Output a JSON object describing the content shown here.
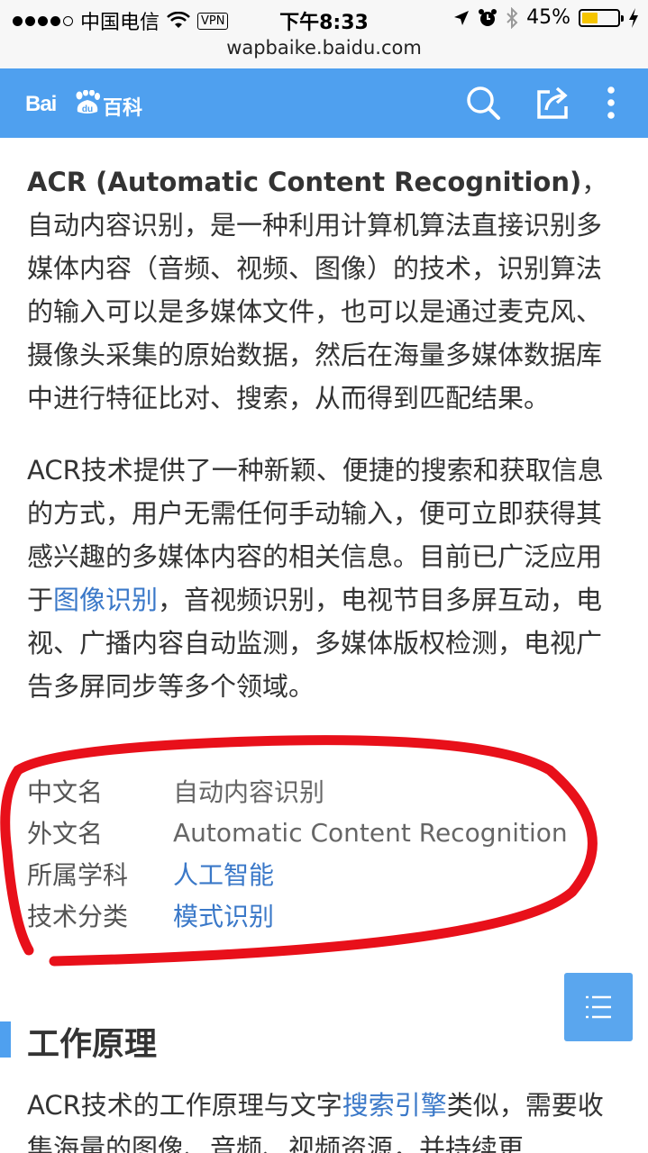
{
  "status_bar": {
    "carrier": "中国电信",
    "vpn": "VPN",
    "time": "下午8:33",
    "battery": "45%",
    "battery_level": 0.45
  },
  "url": "wapbaike.baidu.com",
  "header": {
    "logo_left": "Bai",
    "logo_du": "du",
    "logo_right": "百科",
    "color": "#4fa0ef"
  },
  "article": {
    "p1_bold": "ACR (Automatic Content Recognition)",
    "p1_rest": "，自动内容识别，是一种利用计算机算法直接识别多媒体内容（音频、视频、图像）的技术，识别算法的输入可以是多媒体文件，也可以是通过麦克风、摄像头采集的原始数据，然后在海量多媒体数据库中进行特征比对、搜索，从而得到匹配结果。",
    "p2_a": "ACR技术提供了一种新颖、便捷的搜索和获取信息的方式，用户无需任何手动输入，便可立即获得其感兴趣的多媒体内容的相关信息。目前已广泛应用于",
    "p2_link": "图像识别",
    "p2_b": "，音视频识别，电视节目多屏互动，电视、广播内容自动监测，多媒体版权检测，电视广告多屏同步等多个领域。",
    "infobox": [
      {
        "key": "中文名",
        "value": "自动内容识别",
        "link": false
      },
      {
        "key": "外文名",
        "value": "Automatic Content Recognition",
        "link": false
      },
      {
        "key": "所属学科",
        "value": "人工智能",
        "link": true
      },
      {
        "key": "技术分类",
        "value": "模式识别",
        "link": true
      }
    ],
    "section_title": "工作原理",
    "p3_a": "ACR技术的工作原理与文字",
    "p3_link": "搜索引擎",
    "p3_b": "类似，需要收集海量的图像、音频、视频资源，并持续更"
  },
  "colors": {
    "accent": "#4fa0ef",
    "link": "#3a78c8",
    "annotation": "#e8101a"
  }
}
